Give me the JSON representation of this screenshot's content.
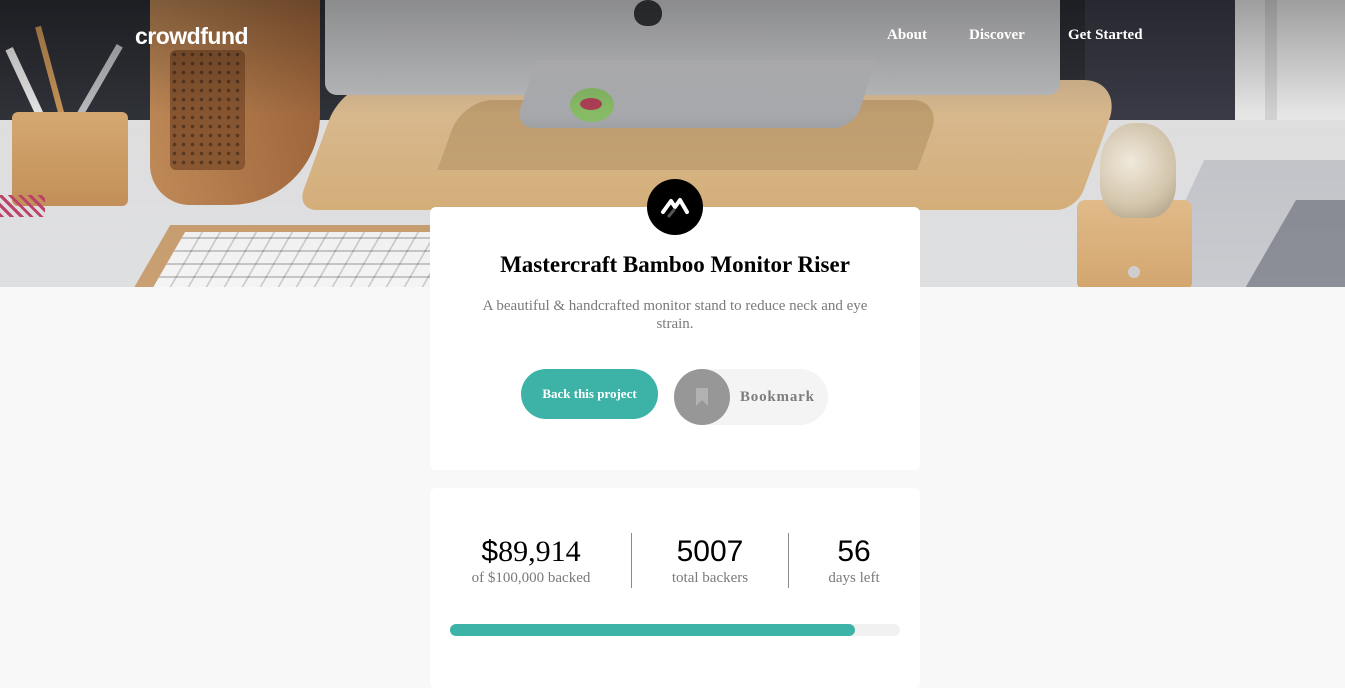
{
  "brand": {
    "logo_text": "crowdfund"
  },
  "nav": {
    "items": [
      "About",
      "Discover",
      "Get Started"
    ]
  },
  "project": {
    "title": "Mastercraft Bamboo Monitor Riser",
    "description": "A beautiful & handcrafted monitor stand to reduce neck and eye strain.",
    "back_button": "Back this project",
    "bookmark_label": "Bookmark",
    "bookmark_icon": "bookmark-icon",
    "logo_icon": "mastercraft-logo-icon"
  },
  "stats": {
    "amount_symbol": "$",
    "amount": "89,914",
    "amount_label": "of $100,000 backed",
    "backers": "5007",
    "backers_label": "total backers",
    "days": "56",
    "days_label": "days left",
    "progress_fraction": 0.899
  },
  "colors": {
    "accent": "#3cb3a6",
    "bookmark_gray": "#979797"
  }
}
